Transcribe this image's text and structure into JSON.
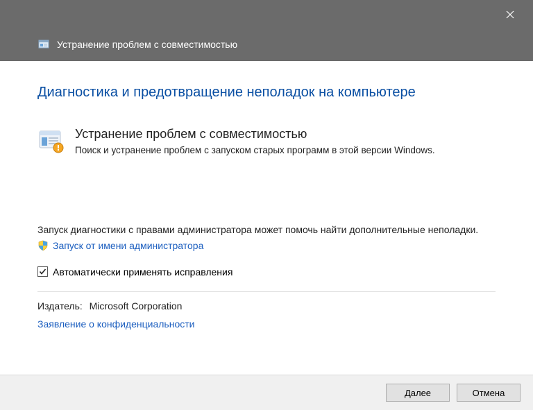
{
  "window": {
    "title": "Устранение проблем с совместимостью"
  },
  "main": {
    "heading": "Диагностика и предотвращение неполадок на компьютере",
    "troubleshooter": {
      "title": "Устранение проблем с совместимостью",
      "description": "Поиск и устранение проблем с запуском старых программ в этой версии Windows."
    },
    "admin_hint": "Запуск диагностики с правами администратора может помочь найти дополнительные неполадки.",
    "admin_link": "Запуск от имени администратора",
    "auto_fix_label": "Автоматически применять исправления",
    "publisher_label": "Издатель:",
    "publisher_value": "Microsoft Corporation",
    "privacy_link": "Заявление о конфиденциальности"
  },
  "footer": {
    "next": "Далее",
    "cancel": "Отмена"
  }
}
